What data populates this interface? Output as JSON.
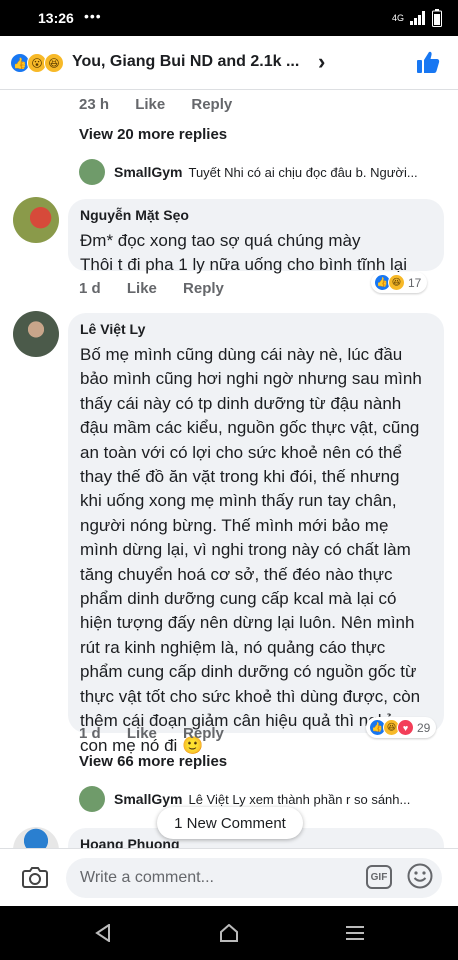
{
  "status_bar": {
    "time": "13:26",
    "dots": "•••",
    "network": "4G",
    "lte": "LTE"
  },
  "header": {
    "title": "You, Giang Bui ND and 2.1k ..."
  },
  "top_comment_meta": {
    "time": "23 h",
    "like": "Like",
    "reply": "Reply"
  },
  "view_more_1": "View 20 more replies",
  "reply_preview_1": {
    "name": "SmallGym",
    "text": "Tuyết Nhi có ai chịu đọc đâu b.  Người..."
  },
  "comment_1": {
    "author": "Nguyễn Mặt Sẹo",
    "lines": [
      "Đm* đọc xong tao sợ quá chúng mày",
      "Thôi t đi pha 1 ly nữa uống cho bình tĩnh lại"
    ],
    "meta": {
      "time": "1 d",
      "like": "Like",
      "reply": "Reply"
    },
    "reaction_count": "17"
  },
  "comment_2": {
    "author": "Lê Việt Ly",
    "lines": [
      "Bố mẹ mình cũng dùng cái này nè, lúc đầu",
      "bảo mình cũng hơi nghi ngờ nhưng sau mình",
      "thấy cái này có tp dinh dưỡng từ đậu nành",
      "đậu mầm các kiểu, nguồn gốc thực vật, cũng",
      "an toàn với có lợi cho sức khoẻ nên có thể",
      "thay thế đồ ăn vặt trong khi đói, thế nhưng",
      "khi uống xong mẹ mình thấy run tay chân,",
      "người nóng bừng. Thế mình mới bảo mẹ",
      "mình dừng lại, vì nghi trong này có chất làm",
      "tăng chuyển hoá cơ sở, thế đéo nào thực",
      "phẩm dinh dưỡng cung cấp kcal mà lại có",
      "hiện tượng đấy nên dừng lại luôn. Nên mình",
      "rút ra kinh nghiệm là, nó quảng cáo thực",
      "phẩm cung cấp dinh dưỡng có nguồn gốc từ",
      "thực vật tốt cho sức khoẻ thì dùng được, còn",
      "thêm cái đoạn giảm cân hiệu quả thì nghỉ",
      "con mẹ nó đi 🙂"
    ],
    "meta": {
      "time": "1 d",
      "like": "Like",
      "reply": "Reply"
    },
    "reaction_count": "29"
  },
  "view_more_2": "View 66 more replies",
  "reply_preview_2": {
    "name": "SmallGym",
    "text": "Lê Việt Ly xem thành phần r so sánh..."
  },
  "comment_3": {
    "author": "Hoang Phuong"
  },
  "toast": "1 New Comment",
  "composer": {
    "placeholder": "Write a comment...",
    "gif_label": "GIF"
  },
  "colors": {
    "accent": "#1877f2",
    "bubble": "#f0f2f5",
    "muted": "#65676b"
  },
  "icons": [
    "signal-icon",
    "battery-icon",
    "like-thumb-icon",
    "camera-icon",
    "gif-icon",
    "emoji-icon",
    "nav-back-icon",
    "nav-home-icon",
    "nav-recent-icon"
  ]
}
